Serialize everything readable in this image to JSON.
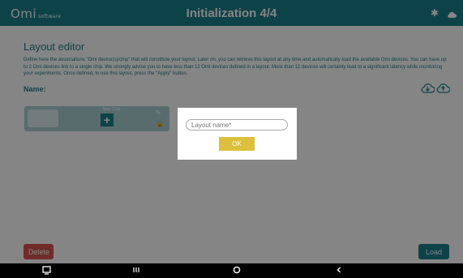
{
  "header": {
    "logo_main": "Omi",
    "logo_sub": "software",
    "title": "Initialization 4/4"
  },
  "editor": {
    "title": "Layout editor",
    "description": "Define here the associations \"Omi device(s)/chip\" that will constitute your layout. Later on, you can retrieve this layout at any time and automatically load the available Omi devices. You can have up to 2 Omi devices link to a single chip. We strongly advise you to have less than 12 Omi devices defined in a layout. More than 12 devices will certainly lead to a significant latency while monitoring your experiments. Once defined, to use this layout, press the \"Apply\" button.",
    "name_label": "Name:"
  },
  "chip": {
    "label": "New Chip",
    "add_symbol": "+"
  },
  "dialog": {
    "placeholder": "Layout name*",
    "ok_label": "OK"
  },
  "footer": {
    "delete_label": "Delete",
    "load_label": "Load"
  },
  "icons": {
    "bluetooth": "bluetooth-icon",
    "cloud": "cloud-icon",
    "download": "cloud-download-icon",
    "upload": "cloud-upload-icon",
    "nav_screenshot": "screenshot-icon",
    "nav_recents": "recents-icon",
    "nav_home": "home-icon",
    "nav_back": "back-icon"
  },
  "colors": {
    "primary": "#1b7f8c",
    "danger": "#d9534f",
    "ok": "#dcbf3a"
  }
}
